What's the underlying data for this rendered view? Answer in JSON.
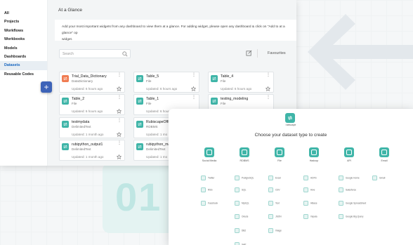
{
  "sidebar": {
    "items": [
      {
        "label": "All"
      },
      {
        "label": "Projects"
      },
      {
        "label": "Workflows"
      },
      {
        "label": "Workbooks"
      },
      {
        "label": "Models"
      },
      {
        "label": "Dashboards"
      },
      {
        "label": "Datasets",
        "active": true
      },
      {
        "label": "Reusable Codes"
      }
    ],
    "add_label": "+"
  },
  "header": {
    "title": "At a Glance",
    "info_line1": "Add your most important widgets from any dashboard to view them at a glance. For adding widget, please open any dashboard & click on \"Add to at a glance\" op",
    "info_line2": "widget."
  },
  "toolbar": {
    "search_placeholder": "Search",
    "favourites_label": "Favourites"
  },
  "cards": [
    {
      "name": "Trial_Data_Dictionary",
      "type": "DataDictionary",
      "updated": "Updated: 6 hours ago",
      "icon_color": "orange"
    },
    {
      "name": "Table_5",
      "type": "File",
      "updated": "Updated: 6 hours ago",
      "icon_color": "teal"
    },
    {
      "name": "Table_4",
      "type": "File",
      "updated": "Updated: 6 hours ago",
      "icon_color": "teal"
    },
    {
      "name": "Table_2",
      "type": "File",
      "updated": "Updated: 6 hours ago",
      "icon_color": "teal"
    },
    {
      "name": "Table_1",
      "type": "File",
      "updated": "Updated: 6 hours ago",
      "icon_color": "teal"
    },
    {
      "name": "testing_modeling",
      "type": "File",
      "updated": "",
      "icon_color": "teal"
    },
    {
      "name": "testmydata",
      "type": "DelimitedText",
      "updated": "Updated: 1 month ago",
      "icon_color": "teal"
    },
    {
      "name": "RubiscapeOfficeL",
      "type": "RDBMS",
      "updated": "Updated: 1 mo",
      "icon_color": "teal"
    },
    {
      "name": "rubipython_output1",
      "type": "DelimitedText",
      "updated": "Updated: 1 month ago",
      "icon_color": "teal"
    },
    {
      "name": "rubipython_ma",
      "type": "DelimitedText",
      "updated": "Updated: 1 mo",
      "icon_color": "teal"
    }
  ],
  "overlay": {
    "logo_text": "rubiscape",
    "title": "Choose your dataset type to create",
    "categories": [
      {
        "label": "Social Media"
      },
      {
        "label": "RDBMS"
      },
      {
        "label": "File"
      },
      {
        "label": "Hadoop"
      },
      {
        "label": "API"
      },
      {
        "label": "Email"
      }
    ],
    "sources": [
      {
        "label": "Twitter"
      },
      {
        "label": "PostgreSQL"
      },
      {
        "label": "Excel"
      },
      {
        "label": "HDFS"
      },
      {
        "label": "Google Home"
      },
      {
        "label": "Gmail"
      },
      {
        "label": "RSS"
      },
      {
        "label": "SQL"
      },
      {
        "label": "CSV"
      },
      {
        "label": "Hive"
      },
      {
        "label": "Salesforce"
      },
      {
        "label": "Facebook"
      },
      {
        "label": "MySQL"
      },
      {
        "label": "Text"
      },
      {
        "label": "HBase"
      },
      {
        "label": "Google Spreadsheet"
      },
      {
        "label": "Oracle"
      },
      {
        "label": "JSON"
      },
      {
        "label": "Impala"
      },
      {
        "label": "Google Big Query"
      },
      {
        "label": "DB2"
      },
      {
        "label": "Image"
      },
      {
        "label": "SAP"
      }
    ]
  },
  "background": {
    "number": "01"
  }
}
